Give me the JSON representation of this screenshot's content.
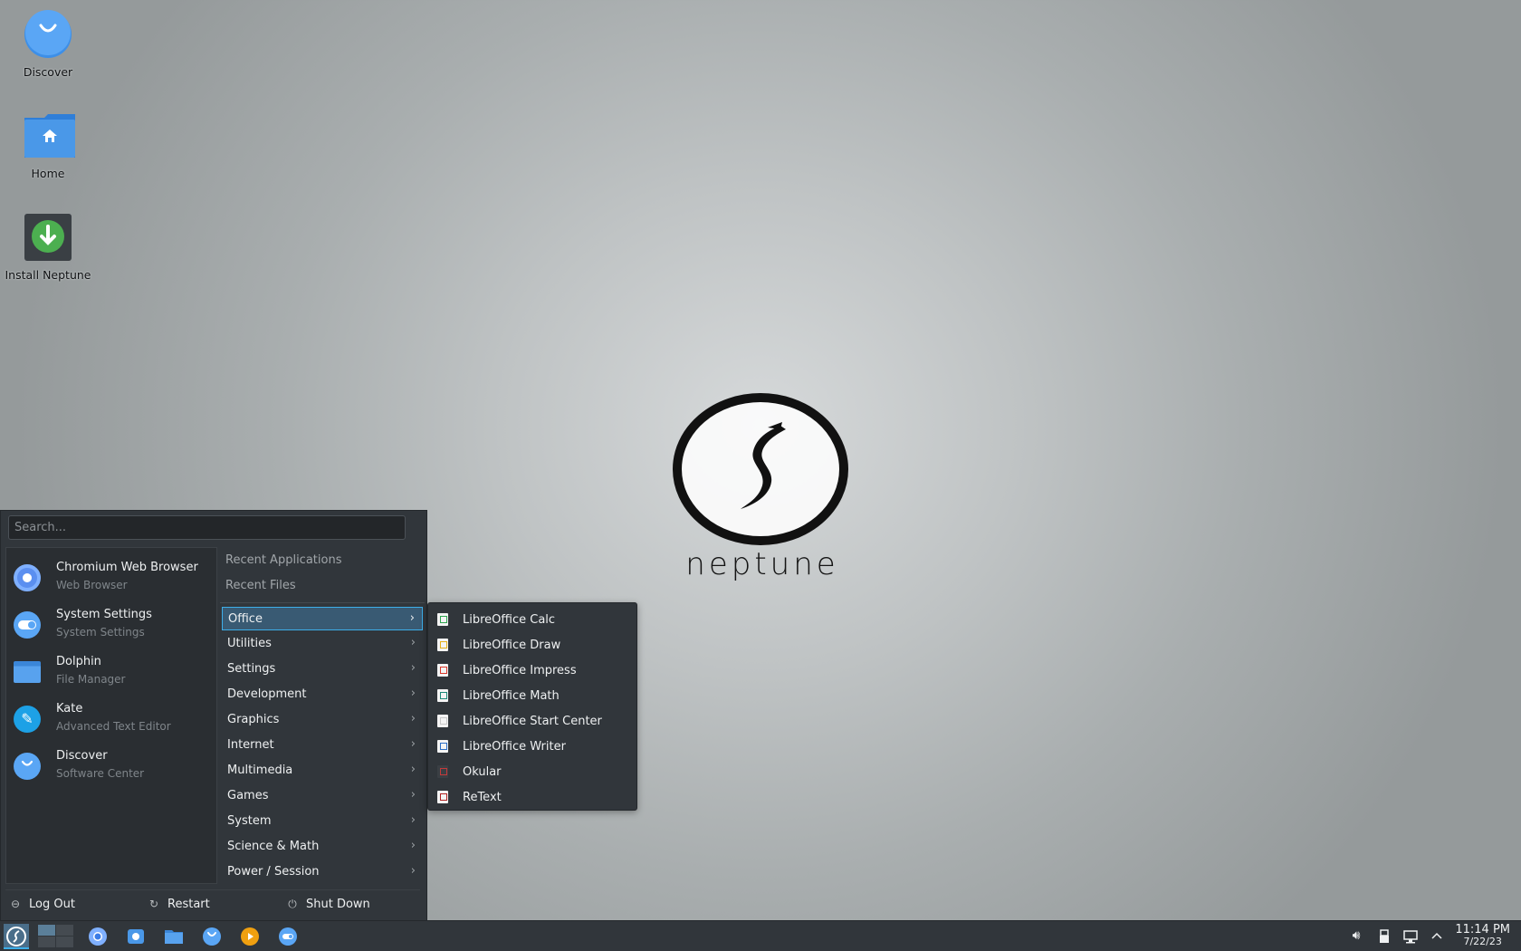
{
  "desktop": {
    "icons": [
      {
        "label": "Discover",
        "icon": "discover-icon"
      },
      {
        "label": "Home",
        "icon": "home-folder-icon"
      },
      {
        "label": "Install Neptune",
        "icon": "install-icon"
      }
    ],
    "wallpaper_logo_text": "neptune"
  },
  "menu": {
    "search_placeholder": "Search...",
    "favorites": [
      {
        "name": "Chromium Web Browser",
        "desc": "Web Browser",
        "icon": "chromium-icon"
      },
      {
        "name": "System Settings",
        "desc": "System Settings",
        "icon": "settings-icon"
      },
      {
        "name": "Dolphin",
        "desc": "File Manager",
        "icon": "folder-icon"
      },
      {
        "name": "Kate",
        "desc": "Advanced Text Editor",
        "icon": "kate-icon"
      },
      {
        "name": "Discover",
        "desc": "Software Center",
        "icon": "discover-icon"
      }
    ],
    "recent": [
      "Recent Applications",
      "Recent Files"
    ],
    "categories": [
      {
        "label": "Office",
        "active": true
      },
      {
        "label": "Utilities"
      },
      {
        "label": "Settings"
      },
      {
        "label": "Development"
      },
      {
        "label": "Graphics"
      },
      {
        "label": "Internet"
      },
      {
        "label": "Multimedia"
      },
      {
        "label": "Games"
      },
      {
        "label": "System"
      },
      {
        "label": "Science & Math"
      },
      {
        "label": "Power / Session"
      }
    ],
    "chevron": "›",
    "footer": {
      "logout": "Log Out",
      "restart": "Restart",
      "shutdown": "Shut Down"
    }
  },
  "submenu": {
    "items": [
      {
        "label": "LibreOffice Calc",
        "color": "#2ea44f"
      },
      {
        "label": "LibreOffice Draw",
        "color": "#e8b21a"
      },
      {
        "label": "LibreOffice Impress",
        "color": "#d9382c"
      },
      {
        "label": "LibreOffice Math",
        "color": "#1d8a7a"
      },
      {
        "label": "LibreOffice Start Center",
        "color": "#c9c9c9"
      },
      {
        "label": "LibreOffice Writer",
        "color": "#2c6fc7"
      },
      {
        "label": "Okular",
        "color": "#c43a3a"
      },
      {
        "label": "ReText",
        "color": "#b22222"
      }
    ]
  },
  "taskbar": {
    "clock_time": "11:14 PM",
    "clock_date": "7/22/23"
  },
  "colors": {
    "accent": "#3daee9",
    "panel": "#31363b"
  }
}
